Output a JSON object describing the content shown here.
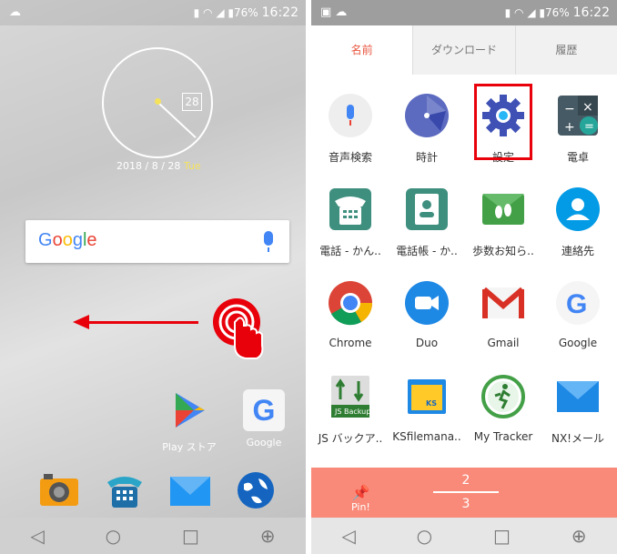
{
  "left": {
    "status": {
      "battery": "76%",
      "time": "16:22"
    },
    "clock": {
      "date_box": "28",
      "date": "2018 / 8 / 28",
      "weekday": "Tue"
    },
    "search": {
      "logo": "Google"
    },
    "home_apps": [
      {
        "label": "Play ストア",
        "icon": "play-store-icon"
      },
      {
        "label": "Google",
        "icon": "google-icon"
      }
    ],
    "dock": [
      {
        "icon": "camera-icon"
      },
      {
        "icon": "phone-icon"
      },
      {
        "icon": "mail-icon"
      },
      {
        "icon": "browser-icon"
      }
    ]
  },
  "right": {
    "status": {
      "battery": "76%",
      "time": "16:22"
    },
    "tabs": [
      "名前",
      "ダウンロード",
      "履歴"
    ],
    "apps": [
      {
        "label": "音声検索",
        "icon": "voice-search-icon"
      },
      {
        "label": "時計",
        "icon": "clock-icon"
      },
      {
        "label": "設定",
        "icon": "settings-gear-icon"
      },
      {
        "label": "電卓",
        "icon": "calculator-icon"
      },
      {
        "label": "電話 - かん..",
        "icon": "phone-simple-icon"
      },
      {
        "label": "電話帳 - か..",
        "icon": "contacts-book-icon"
      },
      {
        "label": "歩数お知ら..",
        "icon": "footsteps-mail-icon"
      },
      {
        "label": "連絡先",
        "icon": "contacts-icon"
      },
      {
        "label": "Chrome",
        "icon": "chrome-icon"
      },
      {
        "label": "Duo",
        "icon": "duo-icon"
      },
      {
        "label": "Gmail",
        "icon": "gmail-icon"
      },
      {
        "label": "Google",
        "icon": "google-icon"
      },
      {
        "label": "JS バックア..",
        "icon": "js-backup-icon"
      },
      {
        "label": "KSfilemana..",
        "icon": "ks-file-manager-icon"
      },
      {
        "label": "My Tracker",
        "icon": "my-tracker-icon"
      },
      {
        "label": "NX!メール",
        "icon": "nx-mail-icon"
      }
    ],
    "pin_label": "Pin!",
    "page_current": "2",
    "page_total": "3"
  },
  "colors": {
    "accent": "#e8000a",
    "pinbar": "#f98a79"
  }
}
